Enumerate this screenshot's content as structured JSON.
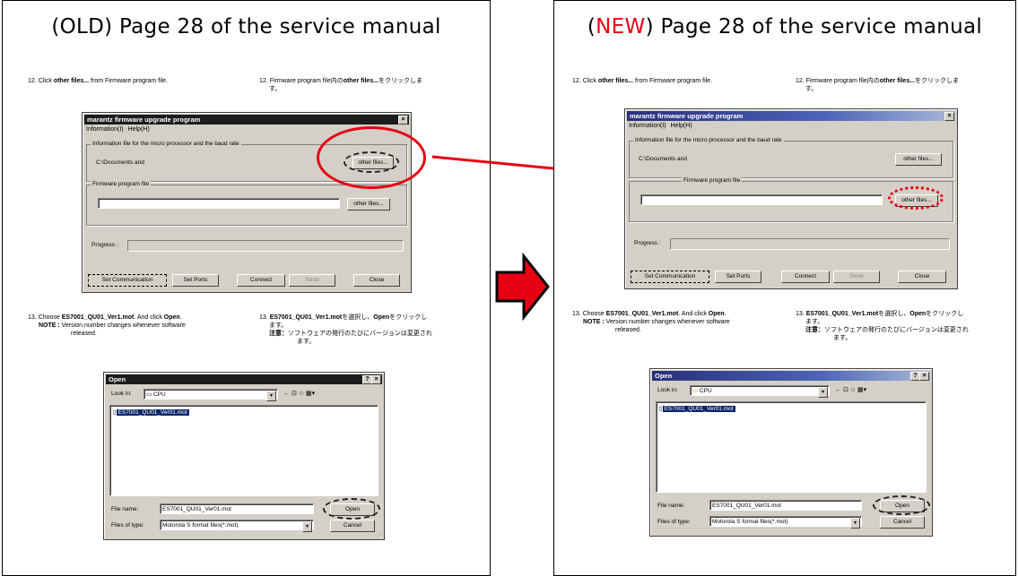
{
  "old": {
    "title": "(OLD) Page 28 of the service manual"
  },
  "new": {
    "title_tag": "NEW",
    "title_rest": "Page 28 of the service manual"
  },
  "steps": {
    "s12_en_num": "12.",
    "s12_en_a": "Click ",
    "s12_en_b": "other files...",
    "s12_en_c": " from Firmware program file.",
    "s12_jp_num": "12.",
    "s12_jp_a": "Firmware program file内の",
    "s12_jp_b": "other files...",
    "s12_jp_c": "をクリックしま",
    "s12_jp_d": "す。",
    "s13_en_num": "13.",
    "s13_en_a": "Choose ",
    "s13_en_b": "ES7001_QU01_Ver1.mot",
    "s13_en_c": ". And click ",
    "s13_en_d": "Open",
    "s13_en_e": ".",
    "s13_note_a": "NOTE : ",
    "s13_note_b": "Version number changes whenever software",
    "s13_note_c": "released.",
    "s13_jp_num": "13.",
    "s13_jp_a": "ES7001_QU01_Ver1.mot",
    "s13_jp_b": "を選択し、",
    "s13_jp_c": "Open",
    "s13_jp_d": "をクリックし",
    "s13_jp_e": "ます。",
    "s13_jp_note_a": "注意：",
    "s13_jp_note_b": "ソフトウェアの発行のたびにバージョンは変更され",
    "s13_jp_note_c": "ます。"
  },
  "upgrade_dialog": {
    "title": "marantz firmware upgrade program",
    "close_glyph": "×",
    "menu_info": "Information(I)",
    "menu_help": "Help(H)",
    "group1_label": "Information file for the micro processor and the baud rate",
    "group1_path": "C:\\Documents and",
    "group2_label": "Firmware program file",
    "other_files": "other files...",
    "progress_label": "Progress :",
    "btn_set_comm": "Set Communication",
    "btn_set_ports": "Set Ports",
    "btn_connect": "Connect",
    "btn_send": "Send",
    "btn_close": "Close"
  },
  "open_dialog": {
    "title": "Open",
    "help_glyph": "?",
    "close_glyph": "×",
    "look_in_label": "Look in:",
    "look_in_value": "CPU",
    "toolbar_glyphs": "← ⊡ ☆ ▦▾",
    "file": "ES7001_QU01_Ver01.mot",
    "file_name_label": "File name:",
    "file_name_value": "ES7001_QU01_Ver01.mot",
    "files_of_type_label": "Files of type:",
    "files_of_type_value": "Motorola S format files(*.mot)",
    "btn_open": "Open",
    "btn_cancel": "Cancel",
    "dropdown_glyph": "▾"
  },
  "colors": {
    "highlight_red": "#e60012",
    "dialog_gray": "#d4d0c8"
  }
}
